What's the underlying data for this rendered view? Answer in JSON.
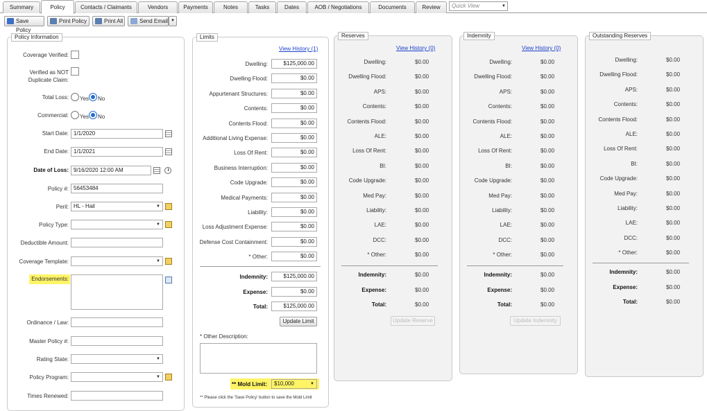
{
  "tabs": [
    "Summary",
    "Policy",
    "Contacts / Claimants",
    "Vendors",
    "Payments",
    "Notes",
    "Tasks",
    "Dates",
    "AOB / Negotiations",
    "Documents",
    "Review"
  ],
  "active_tab": "Policy",
  "quick_view": {
    "placeholder": "Quick View"
  },
  "toolbar": {
    "save": "Save Policy",
    "print": "Print Policy",
    "print_all": "Print All",
    "email": "Send Email"
  },
  "policy_info": {
    "legend": "Policy Information",
    "coverage_verified": "Coverage Verified:",
    "not_duplicate": "Verified as NOT",
    "not_duplicate2": "Duplicate Claim:",
    "total_loss": "Total Loss:",
    "commercial": "Commercial:",
    "yes": "Yes",
    "no": "No",
    "start_date_label": "Start Date:",
    "start_date": "1/1/2020",
    "end_date_label": "End Date:",
    "end_date": "1/1/2021",
    "date_of_loss_label": "Date of Loss:",
    "date_of_loss": "9/16/2020 12:00 AM",
    "policy_num_label": "Policy #:",
    "policy_num": "56453484",
    "peril_label": "Peril:",
    "peril": "HL - Hail",
    "policy_type_label": "Policy Type:",
    "deductible_label": "Deductible Amount:",
    "coverage_template_label": "Coverage Template:",
    "endorsements_label": "Endorsements:",
    "ordinance_label": "Ordinance / Law:",
    "master_policy_label": "Master Policy #:",
    "rating_state_label": "Rating State:",
    "policy_program_label": "Policy Program:",
    "times_renewed_label": "Times Renewed:"
  },
  "limits": {
    "legend": "Limits",
    "view_history": "View History (1)",
    "rows": [
      {
        "label": "Dwelling:",
        "value": "$125,000.00"
      },
      {
        "label": "Dwelling Flood:",
        "value": "$0.00"
      },
      {
        "label": "Appurtenant Structures:",
        "value": "$0.00"
      },
      {
        "label": "Contents:",
        "value": "$0.00"
      },
      {
        "label": "Contents Flood:",
        "value": "$0.00"
      },
      {
        "label": "Additional Living Expense:",
        "value": "$0.00"
      },
      {
        "label": "Loss Of Rent:",
        "value": "$0.00"
      },
      {
        "label": "Business Interruption:",
        "value": "$0.00"
      },
      {
        "label": "Code Upgrade:",
        "value": "$0.00"
      },
      {
        "label": "Medical Payments:",
        "value": "$0.00"
      },
      {
        "label": "Liability:",
        "value": "$0.00"
      },
      {
        "label": "Loss Adjustment Expense:",
        "value": "$0.00"
      },
      {
        "label": "Defense Cost Containment:",
        "value": "$0.00"
      },
      {
        "label": "* Other:",
        "value": "$0.00"
      }
    ],
    "totals": [
      {
        "label": "Indemnity:",
        "value": "$125,000.00"
      },
      {
        "label": "Expense:",
        "value": "$0.00"
      },
      {
        "label": "Total:",
        "value": "$125,000.00"
      }
    ],
    "update_button": "Update Limit",
    "other_description": "* Other Description:",
    "mold_limit_label": "** Mold Limit:",
    "mold_limit": "$10,000",
    "note": "** Please click the 'Save Policy' button to save the Mold Limit"
  },
  "reserves": {
    "legend": "Reserves",
    "view_history": "View History (0)",
    "rows": [
      {
        "label": "Dwelling:",
        "value": "$0.00"
      },
      {
        "label": "Dwelling Flood:",
        "value": "$0.00"
      },
      {
        "label": "APS:",
        "value": "$0.00"
      },
      {
        "label": "Contents:",
        "value": "$0.00"
      },
      {
        "label": "Contents Flood:",
        "value": "$0.00"
      },
      {
        "label": "ALE:",
        "value": "$0.00"
      },
      {
        "label": "Loss Of Rent:",
        "value": "$0.00"
      },
      {
        "label": "BI:",
        "value": "$0.00"
      },
      {
        "label": "Code Upgrade:",
        "value": "$0.00"
      },
      {
        "label": "Med Pay:",
        "value": "$0.00"
      },
      {
        "label": "Liability:",
        "value": "$0.00"
      },
      {
        "label": "LAE:",
        "value": "$0.00"
      },
      {
        "label": "DCC:",
        "value": "$0.00"
      },
      {
        "label": "* Other:",
        "value": "$0.00"
      }
    ],
    "totals": [
      {
        "label": "Indemnity:",
        "value": "$0.00"
      },
      {
        "label": "Expense:",
        "value": "$0.00"
      },
      {
        "label": "Total:",
        "value": "$0.00"
      }
    ],
    "update_button": "Update Reserve"
  },
  "indemnity": {
    "legend": "Indemnity",
    "view_history": "View History (0)",
    "rows": [
      {
        "label": "Dwelling:",
        "value": "$0.00"
      },
      {
        "label": "Dwelling Flood:",
        "value": "$0.00"
      },
      {
        "label": "APS:",
        "value": "$0.00"
      },
      {
        "label": "Contents:",
        "value": "$0.00"
      },
      {
        "label": "Contents Flood:",
        "value": "$0.00"
      },
      {
        "label": "ALE:",
        "value": "$0.00"
      },
      {
        "label": "Loss Of Rent:",
        "value": "$0.00"
      },
      {
        "label": "BI:",
        "value": "$0.00"
      },
      {
        "label": "Code Upgrade:",
        "value": "$0.00"
      },
      {
        "label": "Med Pay:",
        "value": "$0.00"
      },
      {
        "label": "Liability:",
        "value": "$0.00"
      },
      {
        "label": "LAE:",
        "value": "$0.00"
      },
      {
        "label": "DCC:",
        "value": "$0.00"
      },
      {
        "label": "* Other:",
        "value": "$0.00"
      }
    ],
    "totals": [
      {
        "label": "Indemnity:",
        "value": "$0.00"
      },
      {
        "label": "Expense:",
        "value": "$0.00"
      },
      {
        "label": "Total:",
        "value": "$0.00"
      }
    ],
    "update_button": "Update Indemnity"
  },
  "outstanding": {
    "legend": "Outstanding Reserves",
    "rows": [
      {
        "label": "Dwelling:",
        "value": "$0.00"
      },
      {
        "label": "Dwelling Flood:",
        "value": "$0.00"
      },
      {
        "label": "APS:",
        "value": "$0.00"
      },
      {
        "label": "Contents:",
        "value": "$0.00"
      },
      {
        "label": "Contents Flood:",
        "value": "$0.00"
      },
      {
        "label": "ALE:",
        "value": "$0.00"
      },
      {
        "label": "Loss Of Rent:",
        "value": "$0.00"
      },
      {
        "label": "BI:",
        "value": "$0.00"
      },
      {
        "label": "Code Upgrade:",
        "value": "$0.00"
      },
      {
        "label": "Med Pay:",
        "value": "$0.00"
      },
      {
        "label": "Liability:",
        "value": "$0.00"
      },
      {
        "label": "LAE:",
        "value": "$0.00"
      },
      {
        "label": "DCC:",
        "value": "$0.00"
      },
      {
        "label": "* Other:",
        "value": "$0.00"
      }
    ],
    "totals": [
      {
        "label": "Indemnity:",
        "value": "$0.00"
      },
      {
        "label": "Expense:",
        "value": "$0.00"
      },
      {
        "label": "Total:",
        "value": "$0.00"
      }
    ]
  }
}
